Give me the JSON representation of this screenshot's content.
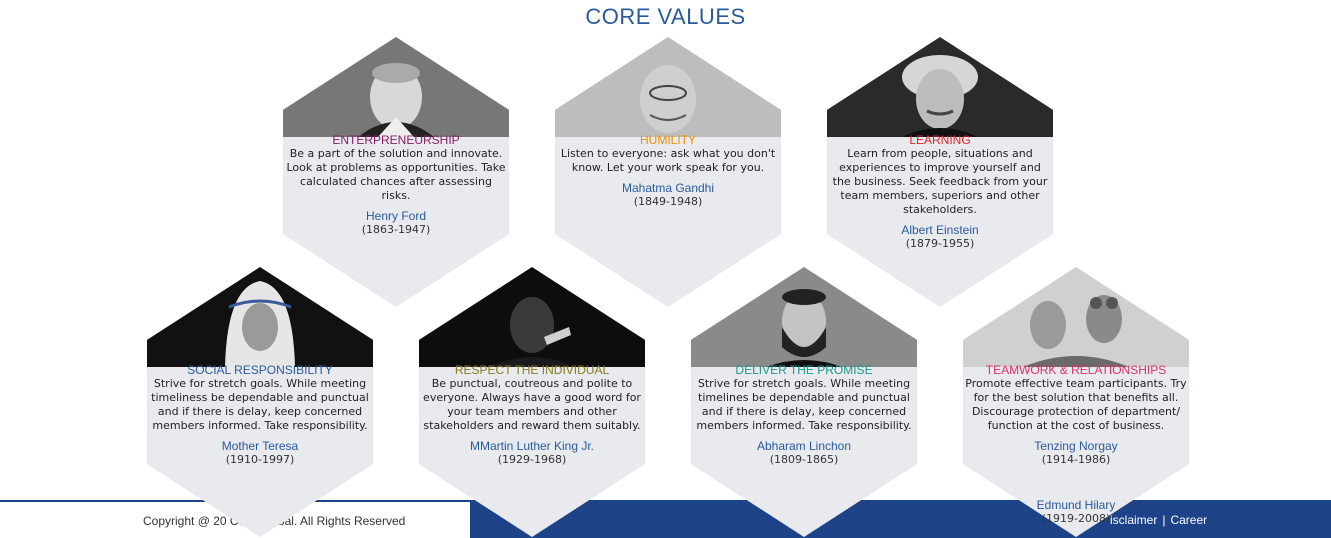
{
  "page_title": "CORE VALUES",
  "footer": {
    "copyright": "Copyright @ 20    Corp Global. All Rights Reserved",
    "links": [
      "isclaimer",
      "Career"
    ],
    "separator": "|"
  },
  "colors": {
    "title": "#2a5a9c",
    "footer_band": "#1e4288",
    "entrepreneurship": "#8b1e6e",
    "humility": "#f29000",
    "learning": "#e8202a",
    "social_responsibility": "#2a5a9c",
    "respect": "#8a7a1e",
    "deliver": "#1a9a8a",
    "teamwork": "#e0306a"
  },
  "values": [
    {
      "title": "ENTERPRENEURSHIP",
      "description": "Be a part of the solution and innovate. Look at problems as opportunities. Take calculated chances after assessing risks.",
      "person": "Henry Ford",
      "years": "(1863-1947)",
      "photo_icon": "portrait-henry-ford-icon"
    },
    {
      "title": "HUMILITY",
      "description": "Listen to everyone: ask what you don't know. Let your work speak for you.",
      "person": "Mahatma Gandhi",
      "years": "(1849-1948)",
      "photo_icon": "portrait-gandhi-icon"
    },
    {
      "title": "LEARNING",
      "description": "Learn from people, situations and experiences to improve yourself and the business. Seek feedback from your team members, superiors and other stakeholders.",
      "person": "Albert Einstein",
      "years": "(1879-1955)",
      "photo_icon": "portrait-einstein-icon"
    },
    {
      "title": "SOCIAL RESPONSIBILITY",
      "description": "Strive for stretch goals. While meeting timeliness be dependable and punctual and if there is delay, keep concerned members informed. Take responsibility.",
      "person": "Mother Teresa",
      "years": "(1910-1997)",
      "photo_icon": "portrait-mother-teresa-icon"
    },
    {
      "title": "RESPECT THE INDIVIDUAL",
      "description": "Be punctual, coutreous and polite to everyone. Always have a good word for your team members and other stakeholders and reward them suitably.",
      "person": "MMartin Luther King Jr.",
      "years": "(1929-1968)",
      "photo_icon": "portrait-mlk-icon"
    },
    {
      "title": "DELIVER THE PROMISE",
      "description": "Strive for stretch goals. While meeting timelines be dependable and punctual and if there is delay, keep concerned members informed. Take responsibility.",
      "person": "Abharam Linchon",
      "years": "(1809-1865)",
      "photo_icon": "portrait-lincoln-icon"
    },
    {
      "title": "TEAMWORK & RELATIONSHIPS",
      "description": "Promote effective team participants. Try for the best solution that benefits all. Discourage protection of department/ function at the cost of business.",
      "person": "Tenzing Norgay",
      "years": "(1914-1986)",
      "person2": "Edmund Hilary",
      "years2": "(1919-2008)",
      "photo_icon": "portrait-tenzing-hillary-icon"
    }
  ]
}
